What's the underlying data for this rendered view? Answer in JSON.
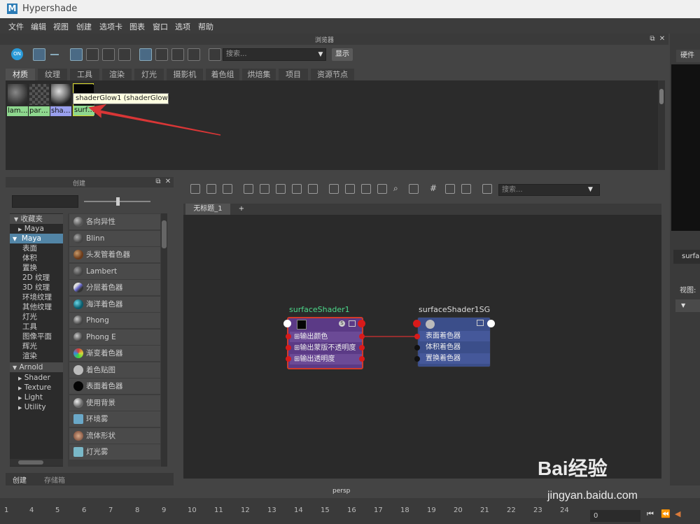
{
  "window": {
    "title": "Hypershade",
    "logo_letter": "M"
  },
  "menu": [
    "文件",
    "编辑",
    "视图",
    "创建",
    "选项卡",
    "图表",
    "窗口",
    "选项",
    "帮助"
  ],
  "browser": {
    "header_title": "浏览器",
    "search_placeholder": "搜索...",
    "show_button": "显示",
    "toolbar_on_label": "ON",
    "tabs": [
      "材质",
      "纹理",
      "工具",
      "渲染",
      "灯光",
      "摄影机",
      "着色组",
      "烘焙集",
      "项目",
      "资源节点"
    ],
    "active_tab": "材质",
    "swatches": [
      {
        "label": "lam…",
        "color": "#8fd88f"
      },
      {
        "label": "par…",
        "color": "#8fd88f"
      },
      {
        "label": "sha…",
        "color": "#9aa0ee"
      },
      {
        "label": "surf…",
        "color": "#8fd88f"
      }
    ],
    "tooltip": "shaderGlow1 (shaderGlow)"
  },
  "create_panel": {
    "header_title": "创建",
    "categories": [
      {
        "label": "收藏夹",
        "kind": "group"
      },
      {
        "label": "Maya",
        "kind": "sub"
      },
      {
        "label": "Maya",
        "kind": "selected"
      },
      {
        "label": "表面",
        "kind": "item"
      },
      {
        "label": "体积",
        "kind": "item"
      },
      {
        "label": "置换",
        "kind": "item"
      },
      {
        "label": "2D 纹理",
        "kind": "item"
      },
      {
        "label": "3D 纹理",
        "kind": "item"
      },
      {
        "label": "环境纹理",
        "kind": "item"
      },
      {
        "label": "其他纹理",
        "kind": "item"
      },
      {
        "label": "灯光",
        "kind": "item"
      },
      {
        "label": "工具",
        "kind": "item"
      },
      {
        "label": "图像平面",
        "kind": "item"
      },
      {
        "label": "辉光",
        "kind": "item"
      },
      {
        "label": "渲染",
        "kind": "item"
      },
      {
        "label": "Arnold",
        "kind": "group"
      },
      {
        "label": "Shader",
        "kind": "sub"
      },
      {
        "label": "Texture",
        "kind": "sub"
      },
      {
        "label": "Light",
        "kind": "sub"
      },
      {
        "label": "Utility",
        "kind": "sub"
      }
    ],
    "nodes": [
      {
        "label": "各向异性",
        "color": "#777"
      },
      {
        "label": "Blinn",
        "color": "#666"
      },
      {
        "label": "头发管着色器",
        "color": "#8a5a3a"
      },
      {
        "label": "Lambert",
        "color": "#777"
      },
      {
        "label": "分层着色器",
        "color": "#9a9ad8"
      },
      {
        "label": "海洋着色器",
        "color": "#2a8a9a"
      },
      {
        "label": "Phong",
        "color": "#777"
      },
      {
        "label": "Phong E",
        "color": "#777"
      },
      {
        "label": "渐变着色器",
        "color": "#d87a3a"
      },
      {
        "label": "着色贴图",
        "color": "#bbb"
      },
      {
        "label": "表面着色器",
        "color": "#111"
      },
      {
        "label": "使用背景",
        "color": "#aaa"
      },
      {
        "label": "环境雾",
        "color": "#6aa8c8"
      },
      {
        "label": "流体形状",
        "color": "#c88a6a"
      },
      {
        "label": "灯光雾",
        "color": "#7ab8c8"
      }
    ],
    "bottom_tabs": [
      "创建",
      "存储箱"
    ]
  },
  "node_editor": {
    "search_placeholder": "搜索...",
    "tab_label": "无标题_1",
    "add_tab": "+",
    "node1": {
      "title": "surfaceShader1",
      "title_color": "#4cd88a",
      "rows": [
        "输出颜色",
        "输出蒙版不透明度",
        "输出透明度"
      ]
    },
    "node2": {
      "title": "surfaceShader1SG",
      "title_color": "#dddddd",
      "rows": [
        "表面着色器",
        "体积着色器",
        "置换着色器"
      ]
    }
  },
  "right_panel": {
    "tab": "硬件",
    "label1": "surfa",
    "label2": "视图:"
  },
  "status": {
    "camera": "persp",
    "timeline_ticks": [
      "1",
      "4",
      "5",
      "6",
      "7",
      "8",
      "9",
      "10",
      "11",
      "12",
      "13",
      "14",
      "15",
      "16",
      "17",
      "18",
      "19",
      "20",
      "21",
      "22",
      "23",
      "24"
    ],
    "current_frame": "0"
  },
  "watermark": {
    "logo": "Bai经验",
    "url": "jingyan.baidu.com"
  }
}
